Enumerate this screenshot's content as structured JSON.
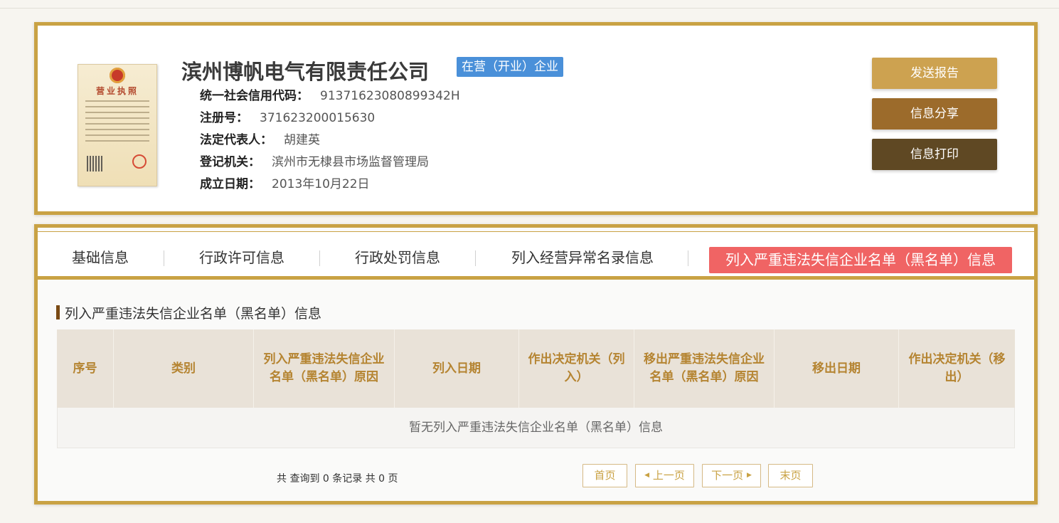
{
  "company": {
    "name": "滨州博帆电气有限责任公司",
    "status": "在营（开业）企业",
    "license_title": "营业执照",
    "fields": [
      {
        "label": "统一社会信用代码：",
        "value": "91371623080899342H"
      },
      {
        "label": "注册号：",
        "value": "371623200015630"
      },
      {
        "label": "法定代表人：",
        "value": "胡建英"
      },
      {
        "label": "登记机关：",
        "value": "滨州市无棣县市场监督管理局"
      },
      {
        "label": "成立日期：",
        "value": "2013年10月22日"
      }
    ]
  },
  "actions": {
    "send_report": "发送报告",
    "share": "信息分享",
    "print": "信息打印"
  },
  "tabs": [
    {
      "label": "基础信息"
    },
    {
      "label": "行政许可信息"
    },
    {
      "label": "行政处罚信息"
    },
    {
      "label": "列入经营异常名录信息"
    },
    {
      "label": "列入严重违法失信企业名单（黑名单）信息"
    }
  ],
  "section": {
    "title": "列入严重违法失信企业名单（黑名单）信息",
    "columns": [
      "序号",
      "类别",
      "列入严重违法失信企业名单（黑名单）原因",
      "列入日期",
      "作出决定机关（列入）",
      "移出严重违法失信企业名单（黑名单）原因",
      "移出日期",
      "作出决定机关（移出）"
    ],
    "empty_text": "暂无列入严重违法失信企业名单（黑名单）信息"
  },
  "pagination": {
    "summary": "共 查询到 0 条记录 共 0 页",
    "first": "首页",
    "prev": "上一页",
    "next": "下一页",
    "last": "末页"
  },
  "colors": {
    "gold_border": "#c9a244",
    "active_tab": "#f06464",
    "status_badge": "#4a90d9"
  }
}
